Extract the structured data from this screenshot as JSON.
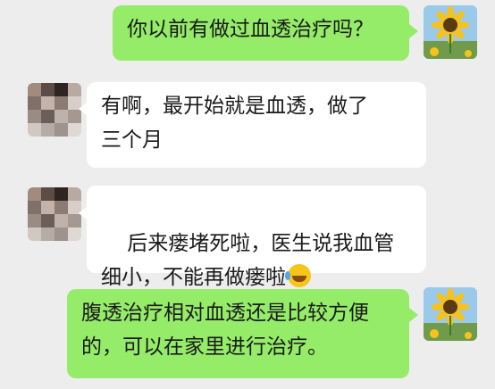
{
  "conversation": {
    "messages": [
      {
        "sender": "me",
        "text": "你以前有做过血透治疗吗？"
      },
      {
        "sender": "other",
        "text": "有啊，最开始就是血透，做了\n三个月"
      },
      {
        "sender": "other",
        "text": "后来瘘堵死啦，医生说我血管\n细小，不能再做瘘啦",
        "emoji": "crying-laughing-emoji"
      },
      {
        "sender": "me",
        "text": "腹透治疗相对血透还是比较方便\n的，可以在家里进行治疗。"
      }
    ]
  },
  "avatars": {
    "me": "sunflower",
    "other": "pixelated-photo"
  },
  "colors": {
    "background": "#ededed",
    "my_bubble": "#95ec69",
    "other_bubble": "#ffffff"
  }
}
